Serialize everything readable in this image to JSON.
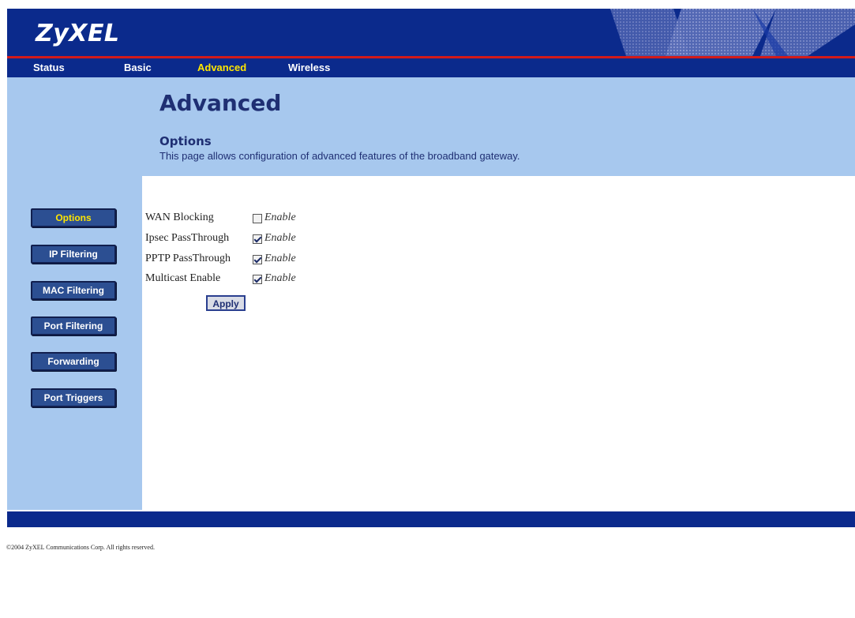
{
  "header": {
    "logo": "ZyXEL"
  },
  "nav": [
    {
      "label": "Status"
    },
    {
      "label": "Basic"
    },
    {
      "label": "Advanced"
    },
    {
      "label": "Wireless"
    }
  ],
  "banner": {
    "title": "Advanced",
    "subtitle": "Options",
    "description": "This page allows configuration of advanced features of the broadband gateway."
  },
  "sidebar": [
    {
      "label": "Options"
    },
    {
      "label": "IP Filtering"
    },
    {
      "label": "MAC Filtering"
    },
    {
      "label": "Port Filtering"
    },
    {
      "label": "Forwarding"
    },
    {
      "label": "Port Triggers"
    }
  ],
  "options": [
    {
      "label": "WAN Blocking",
      "checked": false,
      "enable_label": "Enable"
    },
    {
      "label": "Ipsec PassThrough",
      "checked": true,
      "enable_label": "Enable"
    },
    {
      "label": "PPTP PassThrough",
      "checked": true,
      "enable_label": "Enable"
    },
    {
      "label": "Multicast Enable",
      "checked": true,
      "enable_label": "Enable"
    }
  ],
  "apply_label": "Apply",
  "footer": {
    "copyright": "©2004 ZyXEL Communications Corp.   All rights reserved."
  },
  "colors": {
    "navy": "#0b2a8c",
    "light_blue": "#a7c8ee",
    "active_nav": "#ffe600",
    "red_line": "#d21a1a"
  }
}
